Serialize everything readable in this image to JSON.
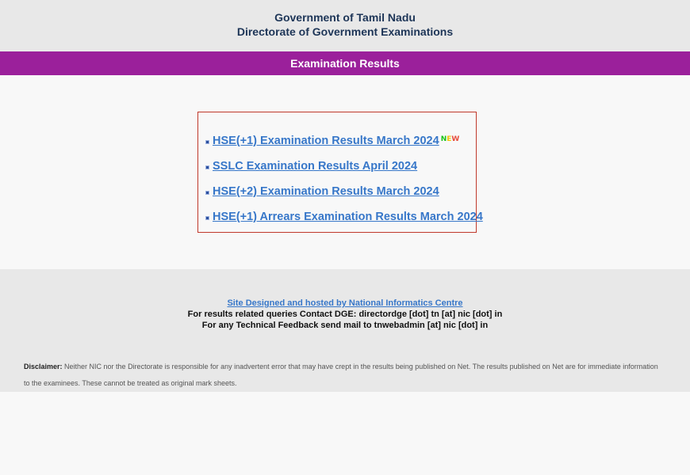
{
  "header": {
    "line1": "Government of Tamil Nadu",
    "line2": "Directorate of Government Examinations"
  },
  "titlebar": {
    "title": "Examination Results"
  },
  "results": [
    {
      "label": "HSE(+1) Examination Results March 2024",
      "new": true
    },
    {
      "label": "SSLC Examination Results April 2024",
      "new": false
    },
    {
      "label": "HSE(+2) Examination Results March 2024",
      "new": false
    },
    {
      "label": "HSE(+1) Arrears Examination Results March 2024",
      "new": false
    }
  ],
  "new_badge": "NEW",
  "footer": {
    "nic_link": "Site Designed and hosted by National Informatics Centre",
    "contact_dge": "For results related queries Contact DGE:  directordge [dot] tn [at] nic [dot] in",
    "contact_tech": "For any Technical Feedback send mail to tnwebadmin [at] nic [dot] in"
  },
  "disclaimer": {
    "label": "Disclaimer:",
    "text": " Neither NIC nor the Directorate is responsible for any inadvertent error that may have crept in the results being published on Net. The results published on Net are for immediate information to the examinees. These cannot be treated as original mark sheets."
  },
  "colors": {
    "titlebar_bg": "#9b209b",
    "link": "#3777c9",
    "box_border": "#c0392b",
    "header_text": "#1d3557"
  }
}
